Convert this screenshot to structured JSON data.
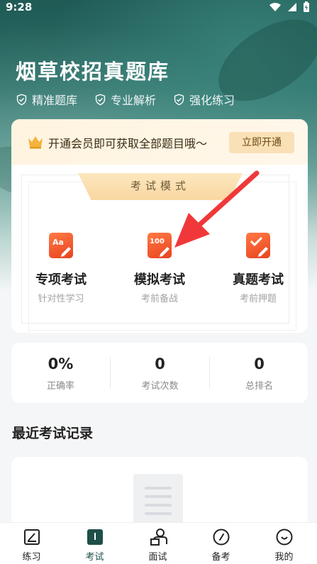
{
  "status_bar": {
    "time": "9:28"
  },
  "hero": {
    "title": "烟草校招真题库",
    "features": [
      "精准题库",
      "专业解析",
      "强化练习"
    ]
  },
  "vip_banner": {
    "text": "开通会员即可获取全部题目哦～",
    "button": "立即开通"
  },
  "exam_mode": {
    "banner": "考试模式",
    "modes": [
      {
        "name": "专项考试",
        "sub": "针对性学习",
        "icon": "aa-edit-icon"
      },
      {
        "name": "模拟考试",
        "sub": "考前备战",
        "icon": "100-edit-icon"
      },
      {
        "name": "真题考试",
        "sub": "考前押题",
        "icon": "check-edit-icon"
      }
    ]
  },
  "stats": [
    {
      "value": "0%",
      "label": "正确率"
    },
    {
      "value": "0",
      "label": "考试次数"
    },
    {
      "value": "0",
      "label": "总排名"
    }
  ],
  "recent": {
    "title": "最近考试记录"
  },
  "tabbar": [
    {
      "label": "练习",
      "icon": "practice-icon"
    },
    {
      "label": "考试",
      "icon": "exam-icon",
      "active": true
    },
    {
      "label": "面试",
      "icon": "interview-icon"
    },
    {
      "label": "备考",
      "icon": "compass-icon"
    },
    {
      "label": "我的",
      "icon": "smile-icon"
    }
  ],
  "colors": {
    "brand_green": "#1f4f49",
    "accent_orange": "#ef4b26",
    "vip_gold": "#fae0b6",
    "arrow_red": "#f0383a"
  }
}
